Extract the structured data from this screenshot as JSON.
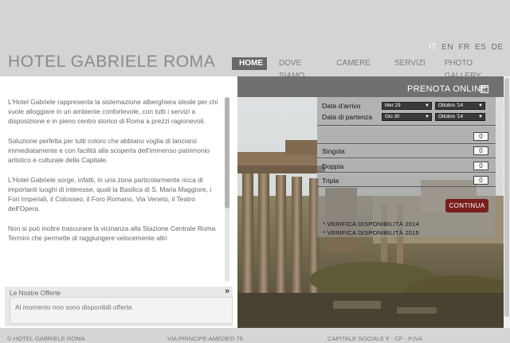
{
  "header": {
    "site_title": "HOTEL GABRIELE ROMA",
    "languages": [
      "IT",
      "EN",
      "FR",
      "ES",
      "DE"
    ],
    "nav": [
      "HOME",
      "DOVE SIAMO",
      "CAMERE",
      "SERVIZI",
      "PHOTO GALLERY"
    ]
  },
  "left": {
    "paragraphs": [
      "L'Hotel Gabriele rappresenta la sistemazione alberghiera ideale per chi vuole alloggiare in un ambiente confortevole, con tutti i servizi a disposizione e in pieno centro storico di Roma a prezzi ragionevoli.",
      "Soluzione perfetta per tutti coloro che abbiano voglia di lanciarsi immediatamente e con facilità alla scoperta dell'immenso patrimonio artistico e culturale della Capitale.",
      "L'Hotel Gabriele sorge, infatti, in una zona particolarmente ricca di importanti luoghi di interesse, quali la Basilica di S. Maria Maggiore, i Fori Imperiali, il Colosseo, il Foro Romano, Via Veneto, il Teatro dell'Opera.",
      "Non si può inoltre trascurare la vicinanza alla Stazione Centrale Roma Termini che permette di raggiungere velocemente altri"
    ],
    "offers_title": "Le Nostre Offerte",
    "offers_text": "Al momento non sono disponibili offerte."
  },
  "booking": {
    "title": "PRENOTA ONLINE",
    "arrival_label": "Data d'arrivo",
    "departure_label": "Data di partenza",
    "arrival_day": "Mer 29",
    "arrival_month": "Ottobre '14",
    "departure_day": "Gio 30",
    "departure_month": "Ottobre '14",
    "rooms": [
      {
        "label": "",
        "value": "0"
      },
      {
        "label": "Singola",
        "value": "0"
      },
      {
        "label": "Doppia",
        "value": "0"
      },
      {
        "label": "Tripla",
        "value": "0"
      }
    ],
    "continue_label": "CONTINUA",
    "verify_2014": "* VERIFICA DISPONIBILITÀ 2014",
    "verify_2015": "* VERIFICA DISPONIBILITÀ 2015"
  },
  "footer": {
    "left": "© HOTEL GABRIELE ROMA",
    "center": "VIA PRINCIPE AMEDEO 76",
    "right": "CAPITALE SOCIALE € - CF - P.IVA"
  }
}
